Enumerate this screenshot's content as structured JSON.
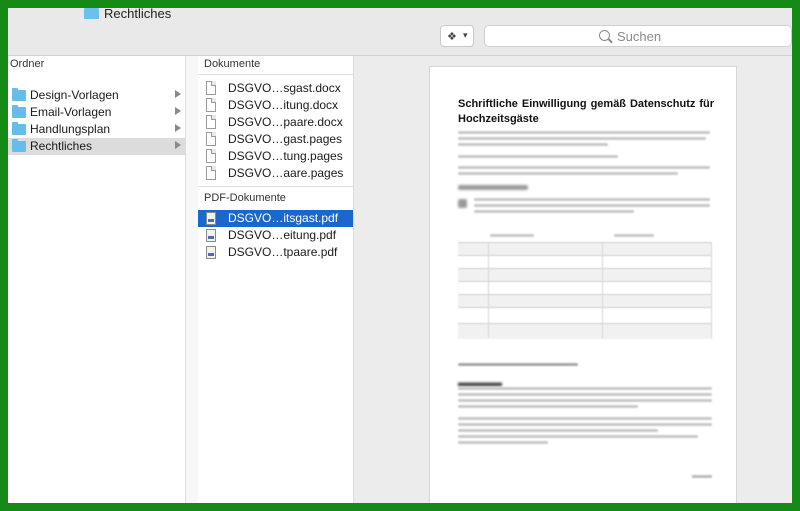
{
  "window": {
    "title": "Rechtliches"
  },
  "toolbar": {
    "dropbox_icon": "dropbox-icon",
    "search_placeholder": "Suchen"
  },
  "sidebar": {
    "header": "Ordner",
    "items": [
      {
        "label": "Design-Vorlagen",
        "selected": false
      },
      {
        "label": "Email-Vorlagen",
        "selected": false
      },
      {
        "label": "Handlungsplan",
        "selected": false
      },
      {
        "label": "Rechtliches",
        "selected": true
      }
    ]
  },
  "files": {
    "documents_header": "Dokumente",
    "documents": [
      {
        "name": "DSGVO…sgast.docx"
      },
      {
        "name": "DSGVO…itung.docx"
      },
      {
        "name": "DSGVO…paare.docx"
      },
      {
        "name": "DSGVO…gast.pages"
      },
      {
        "name": "DSGVO…tung.pages"
      },
      {
        "name": "DSGVO…aare.pages"
      }
    ],
    "pdf_header": "PDF-Dokumente",
    "pdfs": [
      {
        "name": "DSGVO…itsgast.pdf",
        "selected": true
      },
      {
        "name": "DSGVO…eitung.pdf",
        "selected": false
      },
      {
        "name": "DSGVO…tpaare.pdf",
        "selected": false
      }
    ]
  },
  "preview": {
    "title": "Schriftliche Einwilligung gemäß Datenschutz für Hochzeitsgäste"
  },
  "colors": {
    "frame": "#168a16",
    "selection": "#1b67d0",
    "folder": "#66bdea"
  }
}
